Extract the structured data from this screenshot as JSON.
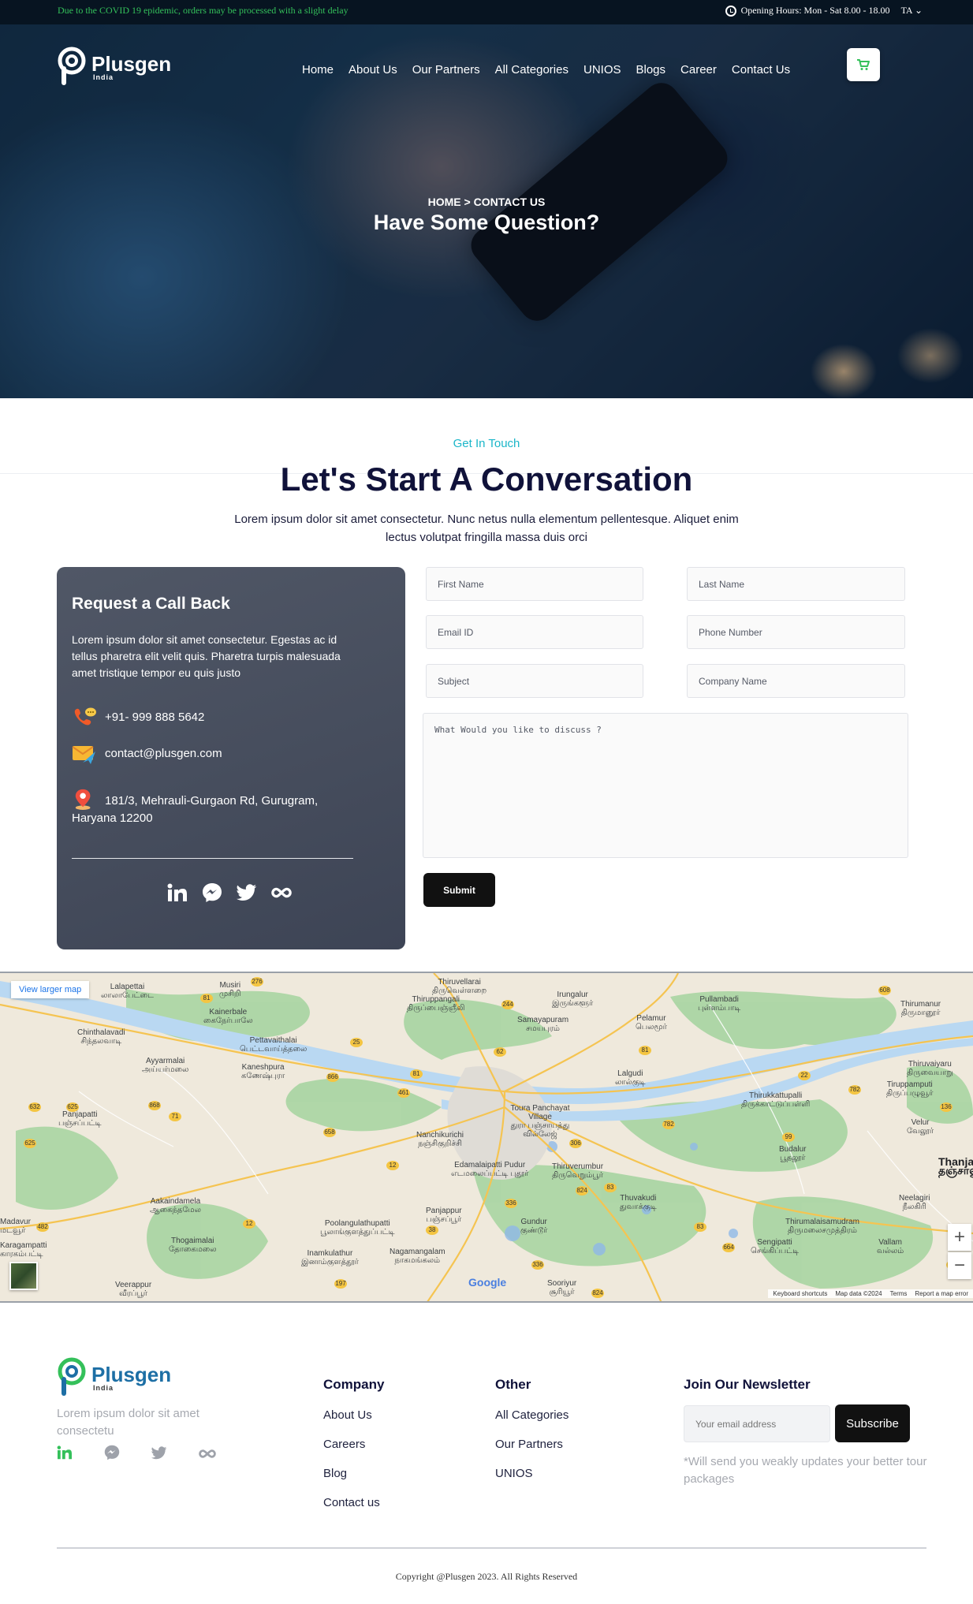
{
  "topbar": {
    "notice": "Due to the COVID 19 epidemic, orders may be processed with a slight delay",
    "hours": "Opening Hours: Mon - Sat 8.00 - 18.00",
    "language": "TA"
  },
  "brand": {
    "name": "Plusgen",
    "sub": "India"
  },
  "nav": {
    "items": [
      {
        "label": "Home"
      },
      {
        "label": "About Us"
      },
      {
        "label": "Our Partners"
      },
      {
        "label": "All Categories"
      },
      {
        "label": "UNIOS"
      },
      {
        "label": "Blogs"
      },
      {
        "label": "Career"
      },
      {
        "label": "Contact Us"
      }
    ]
  },
  "hero": {
    "breadcrumb": "HOME > CONTACT US",
    "title": "Have Some Question?"
  },
  "section": {
    "eyebrow": "Get In Touch",
    "title": "Let's Start A Conversation",
    "description": "Lorem ipsum dolor sit amet consectetur. Nunc netus nulla elementum pellentesque. Aliquet enim lectus volutpat fringilla massa duis orci"
  },
  "callback": {
    "title": "Request a Call Back",
    "description": "Lorem ipsum dolor sit amet consectetur. Egestas ac id tellus pharetra elit velit quis. Pharetra turpis malesuada amet tristique tempor eu quis justo",
    "phone": "+91- 999 888 5642",
    "email": "contact@plusgen.com",
    "address": "181/3, Mehrauli-Gurgaon Rd, Gurugram, Haryana 12200"
  },
  "form": {
    "first_name": "First Name",
    "last_name": "Last Name",
    "email": "Email ID",
    "phone": "Phone Number",
    "subject": "Subject",
    "company": "Company Name",
    "message": "What Would you like to discuss ?",
    "submit": "Submit"
  },
  "map": {
    "view_larger": "View larger map",
    "zoom_in": "+",
    "zoom_out": "−",
    "google": "Google",
    "attribution": [
      "Keyboard shortcuts",
      "Map data ©2024",
      "Terms",
      "Report a map error"
    ],
    "places": [
      {
        "en": "Lalapettai",
        "ta": "லாலாபேட்டை"
      },
      {
        "en": "Musiri",
        "ta": "முசிறி"
      },
      {
        "en": "Thiruvellarai",
        "ta": "திருவெள்ளறை"
      },
      {
        "en": "Irungalur",
        "ta": "இருங்களூர்"
      },
      {
        "en": "Thiruppangali",
        "ta": "திருப்பைஞ்ஞீலி"
      },
      {
        "en": "Pullambadi",
        "ta": "புள்ளம்பாடி"
      },
      {
        "en": "Thirumanur",
        "ta": "திருமானூர்"
      },
      {
        "en": "Kainerbale",
        "ta": "கைநேர்பாலே"
      },
      {
        "en": "Samayapuram",
        "ta": "சமயபுரம்"
      },
      {
        "en": "Pelamur",
        "ta": "பெலமூர்"
      },
      {
        "en": "Chinthalavadi",
        "ta": "சிந்தலவாடி"
      },
      {
        "en": "Pettavaithalai",
        "ta": "பெட்டவாய்த்தலை"
      },
      {
        "en": "Ayyarmalai",
        "ta": "அய்யர்மலை"
      },
      {
        "en": "Kaneshpura",
        "ta": "கணேஷ்புரா"
      },
      {
        "en": "Lalgudi",
        "ta": "லால்குடி"
      },
      {
        "en": "Thiruvaiyaru",
        "ta": "திருவையாறு"
      },
      {
        "en": "Thirukkattupalli",
        "ta": "திருக்காட்டுப்பள்ளி"
      },
      {
        "en": "Tiruppamputi",
        "ta": "திருப்பழுவூர்"
      },
      {
        "en": "Panjapatti",
        "ta": "பஞ்சப்பட்டி"
      },
      {
        "en": "Toura Panchayat Village",
        "ta": "துரா பஞ்சாயத்து வில்லேஜ்"
      },
      {
        "en": "Nanchikurichi",
        "ta": "நஞ்சிகுறிச்சி"
      },
      {
        "en": "Velur",
        "ta": "வேலூர்"
      },
      {
        "en": "Budalur",
        "ta": "பூதலூர்"
      },
      {
        "en": "Thanjavur",
        "ta": "தஞ்சாவூர்"
      },
      {
        "en": "Edamalaipatti Pudur",
        "ta": "எடமலைப்பட்டி புதூர்"
      },
      {
        "en": "Thiruverumbur",
        "ta": "திருவெறும்பூர்"
      },
      {
        "en": "Thuvakudi",
        "ta": "துவாக்குடி"
      },
      {
        "en": "Neelagiri",
        "ta": "நீலகிரி"
      },
      {
        "en": "Aakaindamela",
        "ta": "ஆகைந்தமேல"
      },
      {
        "en": "Panjappur",
        "ta": "பஞ்சப்பூர்"
      },
      {
        "en": "Gundur",
        "ta": "குண்டூர்"
      },
      {
        "en": "Thirumalaisamudram",
        "ta": "திருமலைசமுத்திரம்"
      },
      {
        "en": "Poolangulathupatti",
        "ta": "பூலாங்குளத்துப்பட்டி"
      },
      {
        "en": "Thogaimalai",
        "ta": "தோகைமலை"
      },
      {
        "en": "Sengipatti",
        "ta": "செங்கிப்பட்டி"
      },
      {
        "en": "Vallam",
        "ta": "வல்லம்"
      },
      {
        "en": "Inamkulathur",
        "ta": "இனாம்குளத்தூர்"
      },
      {
        "en": "Nagamangalam",
        "ta": "நாகமங்கலம்"
      },
      {
        "en": "Veerappur",
        "ta": "வீரப்பூர்"
      },
      {
        "en": "Sooriyur",
        "ta": "சூரியூர்"
      },
      {
        "en": "Karagampatti",
        "ta": "காரகம்பட்டி"
      },
      {
        "en": "Madavur",
        "ta": "மடவூர்"
      }
    ],
    "roads": [
      "276",
      "81",
      "244",
      "608",
      "25",
      "62",
      "81",
      "866",
      "461",
      "81",
      "22",
      "782",
      "136",
      "632",
      "625",
      "868",
      "71",
      "658",
      "306",
      "782",
      "99",
      "625",
      "12",
      "824",
      "83",
      "336",
      "12",
      "38",
      "83",
      "664",
      "482",
      "532",
      "336",
      "197",
      "824"
    ]
  },
  "footer": {
    "description": "Lorem ipsum dolor sit amet consectetu",
    "company_head": "Company",
    "company_links": [
      {
        "label": "About Us"
      },
      {
        "label": "Careers"
      },
      {
        "label": "Blog"
      },
      {
        "label": "Contact us"
      }
    ],
    "other_head": "Other",
    "other_links": [
      {
        "label": "All Categories"
      },
      {
        "label": "Our Partners"
      },
      {
        "label": "UNIOS"
      }
    ],
    "newsletter_head": "Join Our Newsletter",
    "newsletter_placeholder": "Your email address",
    "subscribe": "Subscribe",
    "newsletter_note": "*Will send you weakly updates your better tour packages",
    "copyright": "Copyright @Plusgen 2023. All Rights Reserved"
  },
  "colors": {
    "accent": "#1bb6c9",
    "brand_green": "#34c05a",
    "brand_blue": "#1d6fa5",
    "dark_button": "#111111",
    "topbar_bg": "#071421",
    "card_bg": "#4a5060"
  },
  "icons": {
    "topbar": "clock-icon",
    "cart": "cart-icon",
    "phone": "phone-icon",
    "email": "mail-icon",
    "address": "location-pin-icon",
    "socials": [
      "linkedin-icon",
      "messenger-icon",
      "twitter-icon",
      "infinity-icon"
    ]
  }
}
